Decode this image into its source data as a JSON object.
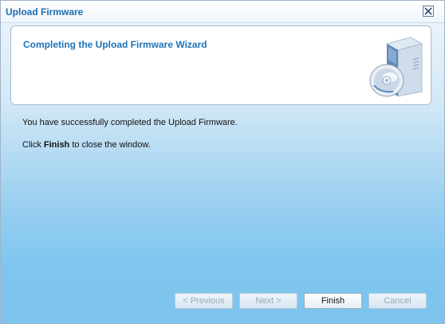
{
  "window": {
    "title": "Upload Firmware"
  },
  "header": {
    "title": "Completing the Upload Firmware Wizard",
    "icon": "software-box-cd-icon"
  },
  "body": {
    "line1": "You have successfully completed the Upload Firmware.",
    "line2_prefix": "Click ",
    "line2_bold": "Finish",
    "line2_suffix": " to close the window."
  },
  "buttons": {
    "previous": "< Previous",
    "next": "Next >",
    "finish": "Finish",
    "cancel": "Cancel"
  },
  "colors": {
    "title": "#1a6eb0",
    "header_title": "#1f73b7"
  }
}
